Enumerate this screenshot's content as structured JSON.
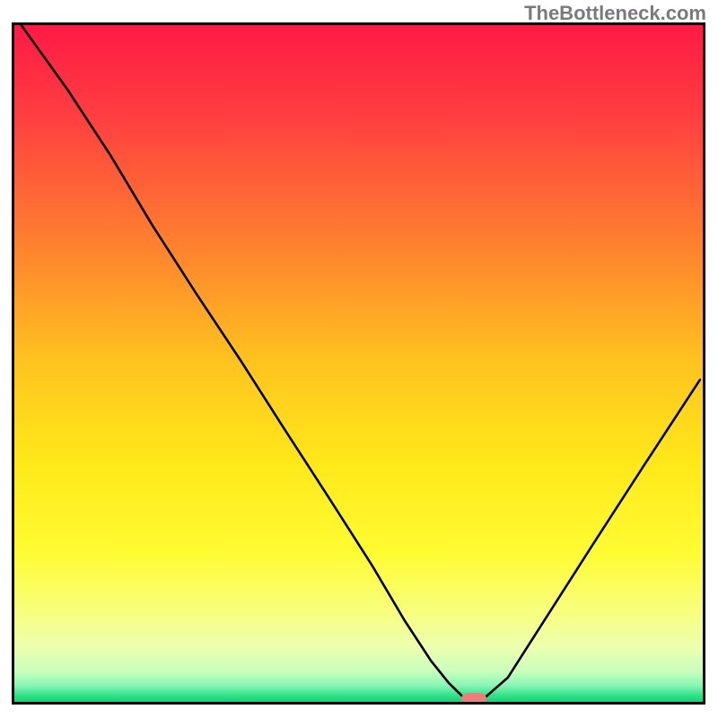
{
  "watermark": "TheBottleneck.com",
  "chart_data": {
    "type": "line",
    "title": "",
    "xlabel": "",
    "ylabel": "",
    "xlim": [
      0,
      100
    ],
    "ylim": [
      0,
      100
    ],
    "grid": false,
    "series": [
      {
        "name": "curve",
        "x_pct": [
          1.0,
          7.7,
          14.0,
          20.0,
          26.5,
          32.9,
          39.3,
          45.6,
          52.0,
          56.7,
          60.5,
          63.1,
          65.4,
          68.2,
          71.7,
          77.6,
          84.0,
          91.5,
          99.6
        ],
        "y_pct": [
          100.0,
          90.5,
          80.7,
          70.5,
          60.2,
          50.4,
          40.2,
          30.3,
          20.1,
          12.0,
          6.1,
          2.8,
          0.5,
          0.5,
          3.6,
          13.0,
          23.2,
          35.0,
          47.6
        ]
      }
    ],
    "marker": {
      "x_pct": 66.8,
      "y_pct": 0.5,
      "color": "#eb7e7b"
    },
    "gradient_stops": [
      {
        "pos": 0.0,
        "color": "#ff1a45"
      },
      {
        "pos": 0.14,
        "color": "#ff4040"
      },
      {
        "pos": 0.35,
        "color": "#ff8a2c"
      },
      {
        "pos": 0.5,
        "color": "#ffc41f"
      },
      {
        "pos": 0.65,
        "color": "#ffe91a"
      },
      {
        "pos": 0.78,
        "color": "#fffc33"
      },
      {
        "pos": 0.87,
        "color": "#f7ff80"
      },
      {
        "pos": 0.92,
        "color": "#ecffb0"
      },
      {
        "pos": 0.955,
        "color": "#c8ffbd"
      },
      {
        "pos": 0.975,
        "color": "#8cf7b6"
      },
      {
        "pos": 0.99,
        "color": "#33e38c"
      },
      {
        "pos": 1.0,
        "color": "#14d176"
      }
    ]
  }
}
